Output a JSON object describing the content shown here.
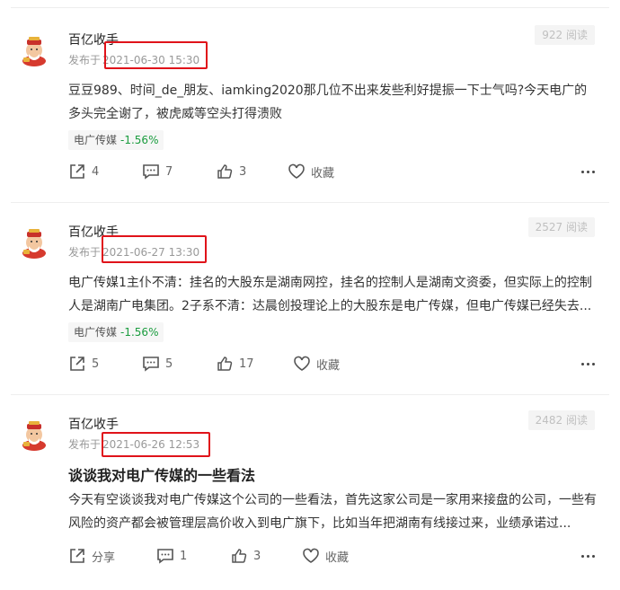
{
  "posts": [
    {
      "author": "百亿收手",
      "published_prefix": "发布于",
      "time": "2021-06-30 15:30",
      "reads": "922 阅读",
      "title": "",
      "content": "豆豆989、时间_de_朋友、iamking2020那几位不出来发些利好提振一下士气吗?今天电广的多头完全谢了，被虎威等空头打得溃败",
      "stock": {
        "name": "电广传媒",
        "change": "-1.56%"
      },
      "actions": {
        "share": "4",
        "comment": "7",
        "like": "3",
        "favorite": "收藏"
      }
    },
    {
      "author": "百亿收手",
      "published_prefix": "发布于",
      "time": "2021-06-27 13:30",
      "reads": "2527 阅读",
      "title": "",
      "content": "电广传媒1主仆不清：挂名的大股东是湖南网控，挂名的控制人是湖南文资委，但实际上的控制人是湖南广电集团。2子系不清：达晨创投理论上的大股东是电广传媒，但电广传媒已经失去...",
      "stock": {
        "name": "电广传媒",
        "change": "-1.56%"
      },
      "actions": {
        "share": "5",
        "comment": "5",
        "like": "17",
        "favorite": "收藏"
      }
    },
    {
      "author": "百亿收手",
      "published_prefix": "发布于",
      "time": "2021-06-26 12:53",
      "reads": "2482 阅读",
      "title": "谈谈我对电广传媒的一些看法",
      "content": "今天有空谈谈我对电广传媒这个公司的一些看法，首先这家公司是一家用来接盘的公司，一些有风险的资产都会被管理层高价收入到电广旗下，比如当年把湖南有线接过来，业绩承诺过...",
      "stock": null,
      "actions": {
        "share": "分享",
        "comment": "1",
        "like": "3",
        "favorite": "收藏"
      }
    }
  ],
  "colors": {
    "negative": "#1a9c3e",
    "highlight": "#e0131a",
    "accent": "#222222"
  },
  "icons": {
    "share": "share-icon",
    "comment": "comment-icon",
    "like": "thumbs-up-icon",
    "favorite": "heart-icon",
    "more": "more-dots-icon",
    "avatar": "caishen-avatar"
  }
}
